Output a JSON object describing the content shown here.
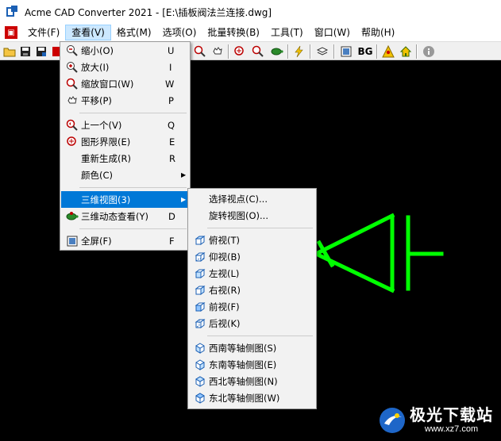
{
  "window": {
    "title": "Acme CAD Converter 2021 - [E:\\插板阀法兰连接.dwg]"
  },
  "menubar": {
    "items": [
      {
        "label": "文件(F)"
      },
      {
        "label": "查看(V)"
      },
      {
        "label": "格式(M)"
      },
      {
        "label": "选项(O)"
      },
      {
        "label": "批量转换(B)"
      },
      {
        "label": "工具(T)"
      },
      {
        "label": "窗口(W)"
      },
      {
        "label": "帮助(H)"
      }
    ]
  },
  "toolbar": {
    "bg_label": "BG"
  },
  "view_menu": {
    "items": [
      {
        "label": "缩小(O)",
        "key": "U",
        "icon": "zoom-out-icon"
      },
      {
        "label": "放大(I)",
        "key": "I",
        "icon": "zoom-in-icon"
      },
      {
        "label": "缩放窗口(W)",
        "key": "W",
        "icon": "zoom-window-icon"
      },
      {
        "label": "平移(P)",
        "key": "P",
        "icon": "pan-hand-icon"
      },
      {
        "label": "上一个(V)",
        "key": "Q",
        "icon": "zoom-previous-icon"
      },
      {
        "label": "图形界限(E)",
        "key": "E",
        "icon": "zoom-extents-icon"
      },
      {
        "label": "重新生成(R)",
        "key": "R",
        "icon": ""
      },
      {
        "label": "颜色(C)",
        "key": "",
        "icon": ""
      },
      {
        "label": "三维视图(3)",
        "key": "",
        "icon": ""
      },
      {
        "label": "三维动态查看(Y)",
        "key": "D",
        "icon": "turtle-icon"
      },
      {
        "label": "全屏(F)",
        "key": "F",
        "icon": "fullscreen-icon"
      }
    ]
  },
  "view3d_menu": {
    "items": [
      {
        "label": "选择视点(C)..."
      },
      {
        "label": "旋转视图(O)..."
      },
      {
        "label": "俯视(T)"
      },
      {
        "label": "仰视(B)"
      },
      {
        "label": "左视(L)"
      },
      {
        "label": "右视(R)"
      },
      {
        "label": "前视(F)"
      },
      {
        "label": "后视(K)"
      },
      {
        "label": "西南等轴侧图(S)"
      },
      {
        "label": "东南等轴侧图(E)"
      },
      {
        "label": "西北等轴侧图(N)"
      },
      {
        "label": "东北等轴侧图(W)"
      }
    ]
  },
  "watermark": {
    "name": "极光下载站",
    "url": "www.xz7.com"
  },
  "colors": {
    "canvas": "#000000",
    "drawing": "#00ff00",
    "highlight": "#0078d7"
  }
}
